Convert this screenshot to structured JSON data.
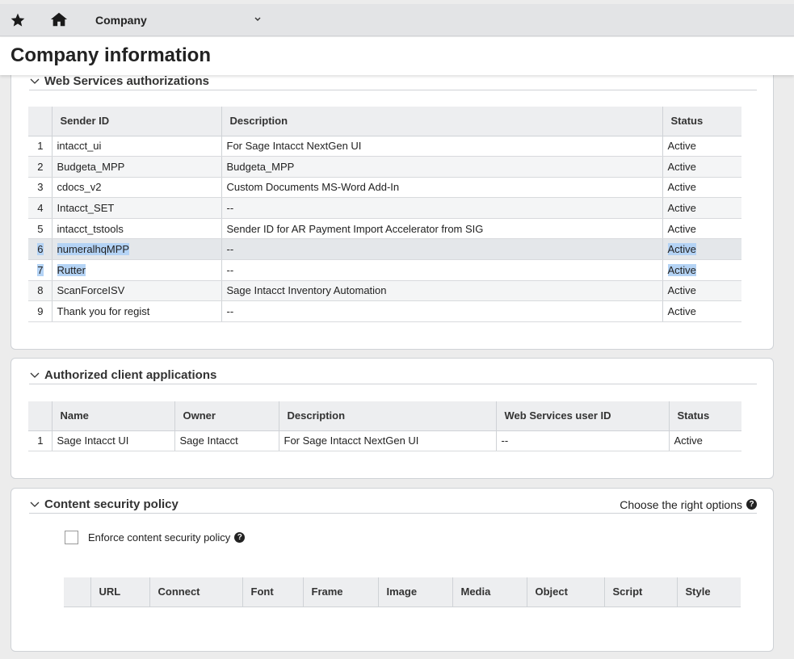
{
  "topbar": {
    "company_label": "Company"
  },
  "page": {
    "title": "Company information"
  },
  "web_services": {
    "title": "Web Services authorizations",
    "columns": [
      "",
      "Sender ID",
      "Description",
      "Status"
    ],
    "rows": [
      {
        "num": "1",
        "sender_id": "intacct_ui",
        "description": "For Sage Intacct NextGen UI",
        "status": "Active"
      },
      {
        "num": "2",
        "sender_id": "Budgeta_MPP",
        "description": "Budgeta_MPP",
        "status": "Active"
      },
      {
        "num": "3",
        "sender_id": "cdocs_v2",
        "description": "Custom Documents MS-Word Add-In",
        "status": "Active"
      },
      {
        "num": "4",
        "sender_id": "Intacct_SET",
        "description": "--",
        "status": "Active"
      },
      {
        "num": "5",
        "sender_id": "intacct_tstools",
        "description": "Sender ID for AR Payment Import Accelerator from SIG",
        "status": "Active"
      },
      {
        "num": "6",
        "sender_id": "numeralhqMPP",
        "description": "--",
        "status": "Active"
      },
      {
        "num": "7",
        "sender_id": "Rutter",
        "description": "--",
        "status": "Active"
      },
      {
        "num": "8",
        "sender_id": "ScanForceISV",
        "description": "Sage Intacct Inventory Automation",
        "status": "Active"
      },
      {
        "num": "9",
        "sender_id": "Thank you for regist",
        "description": "--",
        "status": "Active"
      }
    ]
  },
  "client_apps": {
    "title": "Authorized client applications",
    "columns": [
      "",
      "Name",
      "Owner",
      "Description",
      "Web Services user ID",
      "Status"
    ],
    "rows": [
      {
        "num": "1",
        "name": "Sage Intacct UI",
        "owner": "Sage Intacct",
        "description": "For Sage Intacct NextGen UI",
        "ws_user": "--",
        "status": "Active"
      }
    ]
  },
  "csp": {
    "title": "Content security policy",
    "right_label": "Choose the right options",
    "checkbox_label": "Enforce content security policy",
    "columns": [
      "",
      "URL",
      "Connect",
      "Font",
      "Frame",
      "Image",
      "Media",
      "Object",
      "Script",
      "Style"
    ]
  },
  "colors": {
    "topbar_bg": "#e3e4e6",
    "selection_highlight": "#b4d3f5",
    "header_bg": "#edeef0"
  }
}
